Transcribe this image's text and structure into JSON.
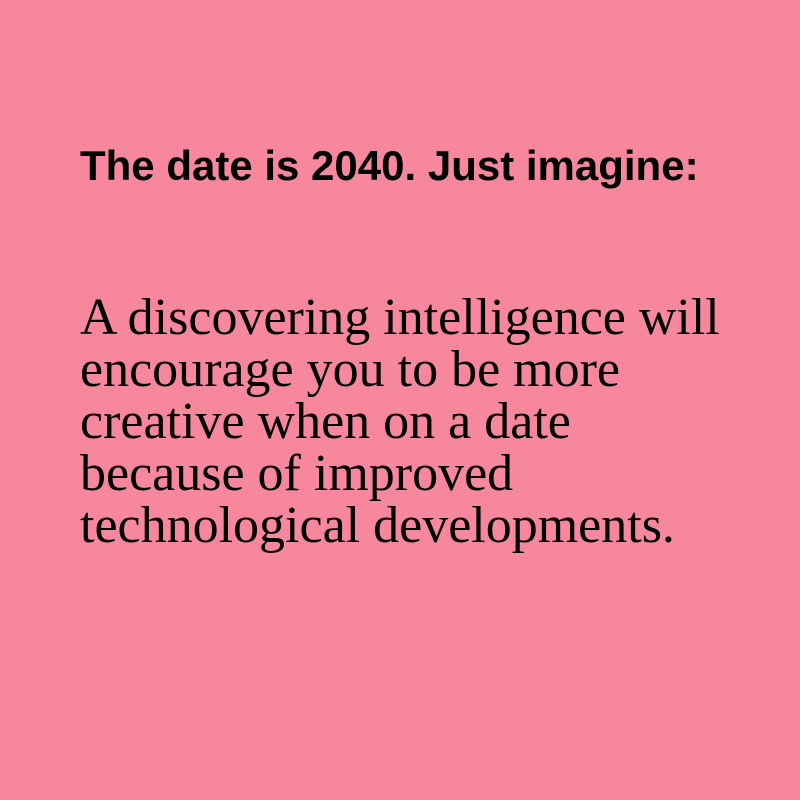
{
  "background_color": "#f7879c",
  "text_color": "#000000",
  "headline": "The date is 2040. Just imagine:",
  "body": "A discovering intelligence will encourage you to be more creative when on a date because of improved technological developments."
}
